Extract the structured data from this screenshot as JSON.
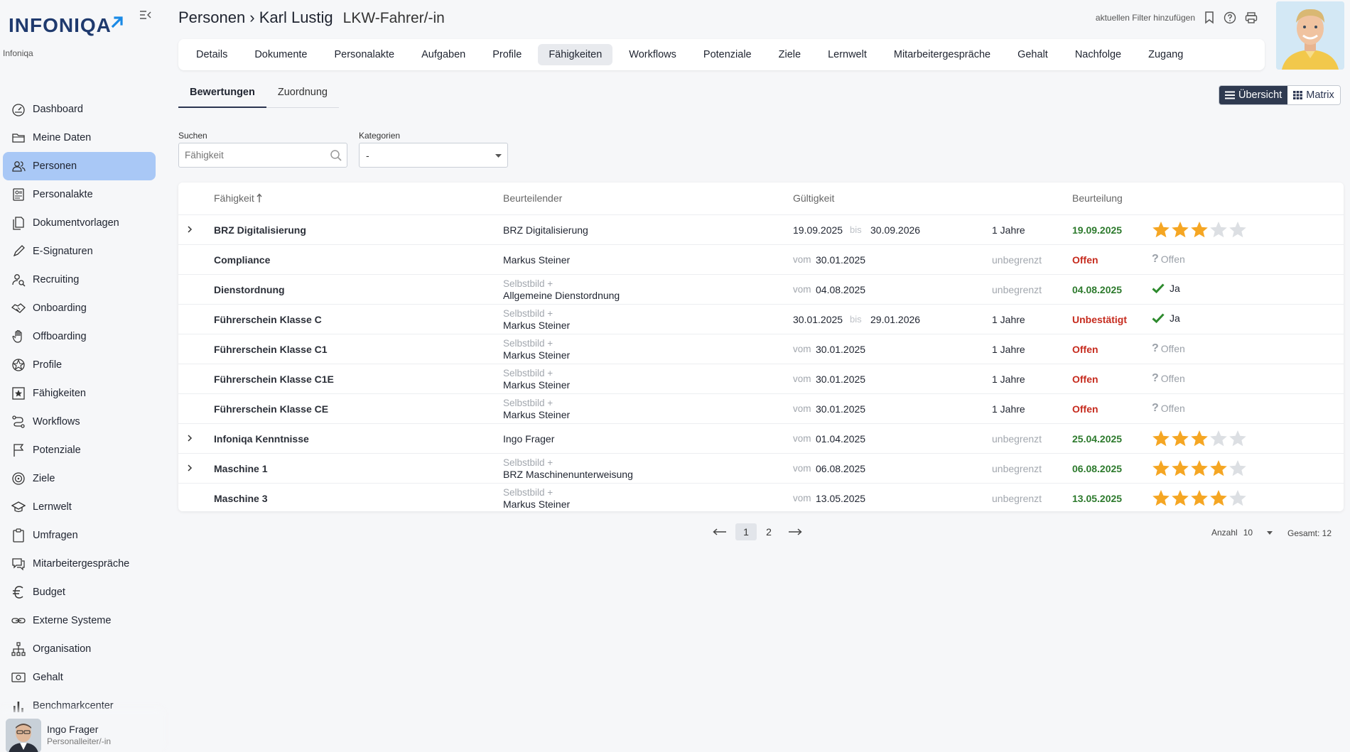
{
  "app": {
    "logo_text": "INFONIQA",
    "tenant": "Infoniqa",
    "brand_color": "#1f3a6e",
    "accent_color": "#1a8ae6"
  },
  "sidebar": {
    "items": [
      {
        "label": "Dashboard",
        "icon": "dashboard-icon"
      },
      {
        "label": "Meine Daten",
        "icon": "folder-icon"
      },
      {
        "label": "Personen",
        "icon": "people-icon",
        "active": true
      },
      {
        "label": "Personalakte",
        "icon": "personnel-file-icon"
      },
      {
        "label": "Dokumentvorlagen",
        "icon": "document-template-icon"
      },
      {
        "label": "E-Signaturen",
        "icon": "pen-icon"
      },
      {
        "label": "Recruiting",
        "icon": "recruiting-icon"
      },
      {
        "label": "Onboarding",
        "icon": "handshake-icon"
      },
      {
        "label": "Offboarding",
        "icon": "hand-icon"
      },
      {
        "label": "Profile",
        "icon": "profile-icon"
      },
      {
        "label": "Fähigkeiten",
        "icon": "star-icon"
      },
      {
        "label": "Workflows",
        "icon": "workflow-icon"
      },
      {
        "label": "Potenziale",
        "icon": "flag-icon"
      },
      {
        "label": "Ziele",
        "icon": "target-icon"
      },
      {
        "label": "Lernwelt",
        "icon": "graduation-icon"
      },
      {
        "label": "Umfragen",
        "icon": "clipboard-icon"
      },
      {
        "label": "Mitarbeitergespräche",
        "icon": "chat-icon"
      },
      {
        "label": "Budget",
        "icon": "euro-icon"
      },
      {
        "label": "Externe Systeme",
        "icon": "link-icon"
      },
      {
        "label": "Organisation",
        "icon": "org-chart-icon"
      },
      {
        "label": "Gehalt",
        "icon": "money-icon"
      },
      {
        "label": "Benchmarkcenter",
        "icon": "bar-chart-icon"
      }
    ],
    "user": {
      "name": "Ingo Frager",
      "role": "Personalleiter/-in"
    }
  },
  "header": {
    "breadcrumb": "Personen › Karl Lustig",
    "subtitle": "LKW-Fahrer/-in",
    "filter_link": "aktuellen Filter hinzufügen"
  },
  "tabs": [
    "Details",
    "Dokumente",
    "Personalakte",
    "Aufgaben",
    "Profile",
    "Fähigkeiten",
    "Workflows",
    "Potenziale",
    "Ziele",
    "Lernwelt",
    "Mitarbeitergespräche",
    "Gehalt",
    "Nachfolge",
    "Zugang"
  ],
  "active_tab": "Fähigkeiten",
  "subtabs": [
    "Bewertungen",
    "Zuordnung"
  ],
  "view_toggle": {
    "overview": "Übersicht",
    "matrix": "Matrix"
  },
  "filters": {
    "search_label": "Suchen",
    "search_placeholder": "Fähigkeit",
    "category_label": "Kategorien",
    "category_value": "-"
  },
  "table": {
    "headers": {
      "skill": "Fähigkeit",
      "evaluator": "Beurteilender",
      "validity": "Gültigkeit",
      "assessment": "Beurteilung"
    },
    "rows": [
      {
        "expand": true,
        "skill": "BRZ Digitalisierung",
        "evaluator_top": "",
        "evaluator": "BRZ Digitalisierung",
        "from_label": "",
        "from": "19.09.2025",
        "bis": "bis",
        "to": "30.09.2026",
        "duration": "1 Jahre",
        "status": "19.09.2025",
        "status_type": "green",
        "rating_type": "stars",
        "stars": 3
      },
      {
        "expand": false,
        "skill": "Compliance",
        "evaluator_top": "",
        "evaluator": "Markus Steiner",
        "from_label": "vom",
        "from": "30.01.2025",
        "bis": "",
        "to": "",
        "duration": "unbegrenzt",
        "status": "Offen",
        "status_type": "red",
        "rating_type": "offen",
        "rating_text": "Offen"
      },
      {
        "expand": false,
        "skill": "Dienstordnung",
        "evaluator_top": "Selbstbild +",
        "evaluator": "Allgemeine Dienstordnung",
        "from_label": "vom",
        "from": "04.08.2025",
        "bis": "",
        "to": "",
        "duration": "unbegrenzt",
        "status": "04.08.2025",
        "status_type": "green",
        "rating_type": "ja",
        "rating_text": "Ja"
      },
      {
        "expand": false,
        "skill": "Führerschein Klasse C",
        "evaluator_top": "Selbstbild +",
        "evaluator": "Markus Steiner",
        "from_label": "",
        "from": "30.01.2025",
        "bis": "bis",
        "to": "29.01.2026",
        "duration": "1 Jahre",
        "status": "Unbestätigt",
        "status_type": "red",
        "rating_type": "ja",
        "rating_text": "Ja"
      },
      {
        "expand": false,
        "skill": "Führerschein Klasse C1",
        "evaluator_top": "Selbstbild +",
        "evaluator": "Markus Steiner",
        "from_label": "vom",
        "from": "30.01.2025",
        "bis": "",
        "to": "",
        "duration": "1 Jahre",
        "status": "Offen",
        "status_type": "red",
        "rating_type": "offen",
        "rating_text": "Offen"
      },
      {
        "expand": false,
        "skill": "Führerschein Klasse C1E",
        "evaluator_top": "Selbstbild +",
        "evaluator": "Markus Steiner",
        "from_label": "vom",
        "from": "30.01.2025",
        "bis": "",
        "to": "",
        "duration": "1 Jahre",
        "status": "Offen",
        "status_type": "red",
        "rating_type": "offen",
        "rating_text": "Offen"
      },
      {
        "expand": false,
        "skill": "Führerschein Klasse CE",
        "evaluator_top": "Selbstbild +",
        "evaluator": "Markus Steiner",
        "from_label": "vom",
        "from": "30.01.2025",
        "bis": "",
        "to": "",
        "duration": "1 Jahre",
        "status": "Offen",
        "status_type": "red",
        "rating_type": "offen",
        "rating_text": "Offen"
      },
      {
        "expand": true,
        "skill": "Infoniqa Kenntnisse",
        "evaluator_top": "",
        "evaluator": "Ingo Frager",
        "from_label": "vom",
        "from": "01.04.2025",
        "bis": "",
        "to": "",
        "duration": "unbegrenzt",
        "status": "25.04.2025",
        "status_type": "green",
        "rating_type": "stars",
        "stars": 3
      },
      {
        "expand": true,
        "skill": "Maschine 1",
        "evaluator_top": "Selbstbild +",
        "evaluator": "BRZ Maschinenunterweisung",
        "from_label": "vom",
        "from": "06.08.2025",
        "bis": "",
        "to": "",
        "duration": "unbegrenzt",
        "status": "06.08.2025",
        "status_type": "green",
        "rating_type": "stars",
        "stars": 4
      },
      {
        "expand": false,
        "skill": "Maschine 3",
        "evaluator_top": "Selbstbild +",
        "evaluator": "Markus Steiner",
        "from_label": "vom",
        "from": "13.05.2025",
        "bis": "",
        "to": "",
        "duration": "unbegrenzt",
        "status": "13.05.2025",
        "status_type": "green",
        "rating_type": "stars",
        "stars": 4
      }
    ]
  },
  "pagination": {
    "pages": [
      "1",
      "2"
    ],
    "current": "1",
    "anzahl_label": "Anzahl",
    "anzahl_value": "10",
    "total": "Gesamt: 12"
  },
  "colors": {
    "star_filled": "#f5a623",
    "star_empty": "#dcdfe3",
    "status_green": "#2d7a2d",
    "status_red": "#c62b1e",
    "check_green": "#2d8a2d"
  }
}
